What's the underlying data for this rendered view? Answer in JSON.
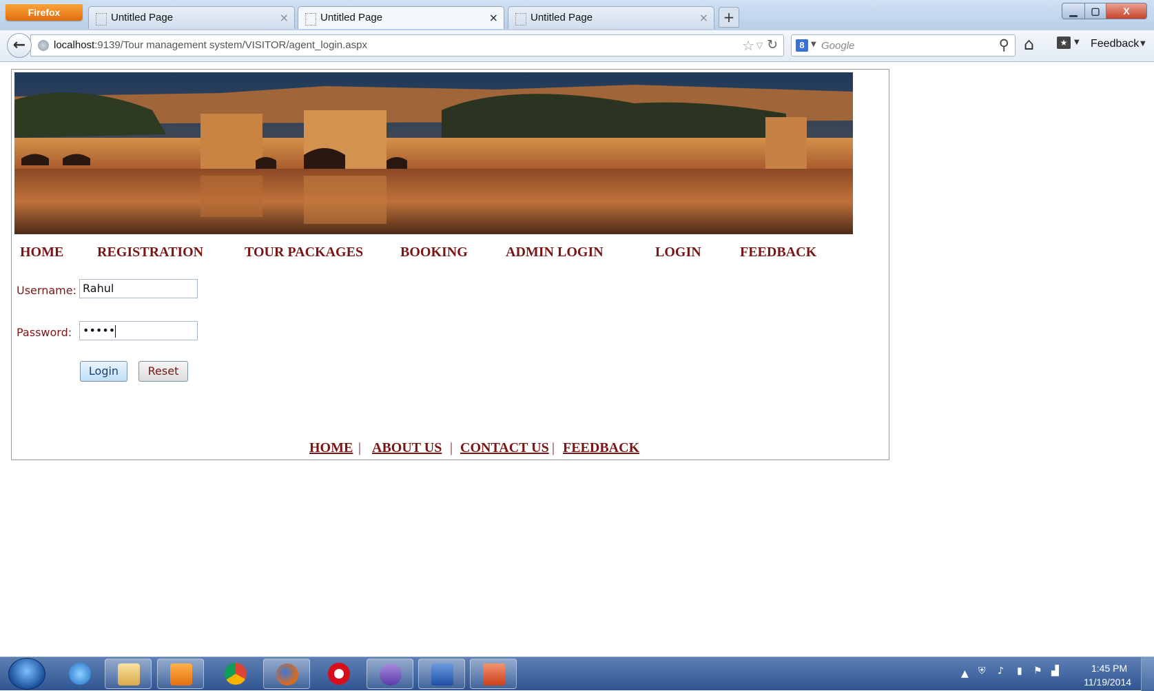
{
  "browser": {
    "menu_label": "Firefox",
    "tabs": [
      {
        "label": "Untitled Page"
      },
      {
        "label": "Untitled Page"
      },
      {
        "label": "Untitled Page"
      }
    ],
    "active_tab_index": 1,
    "url_host": "localhost",
    "url_rest": ":9139/Tour management system/VISITOR/agent_login.aspx",
    "search_placeholder": "Google",
    "feedback_label": "Feedback"
  },
  "nav_menu": [
    {
      "label": "HOME"
    },
    {
      "label": "REGISTRATION"
    },
    {
      "label": "TOUR PACKAGES"
    },
    {
      "label": "BOOKING"
    },
    {
      "label": "ADMIN LOGIN"
    },
    {
      "label": "LOGIN"
    },
    {
      "label": "FEEDBACK"
    }
  ],
  "login_form": {
    "username_label": "Username:",
    "username_value": "Rahul",
    "password_label": "Password:",
    "password_masked": "•••••",
    "login_button": "Login",
    "reset_button": "Reset"
  },
  "footer": {
    "links": [
      {
        "label": "HOME"
      },
      {
        "label": "ABOUT US"
      },
      {
        "label": "CONTACT US"
      },
      {
        "label": "FEEDBACK"
      }
    ],
    "separator": "|"
  },
  "taskbar": {
    "apps": [
      "internet-explorer",
      "file-explorer",
      "media-player",
      "chrome",
      "firefox",
      "opera",
      "visual-studio",
      "word",
      "powerpoint"
    ],
    "clock_time": "1:45 PM",
    "clock_date": "11/19/2014"
  },
  "colors": {
    "menu_text": "#7a1515",
    "titlebar": "#c4d7ee",
    "taskbar": "#3f649f"
  }
}
